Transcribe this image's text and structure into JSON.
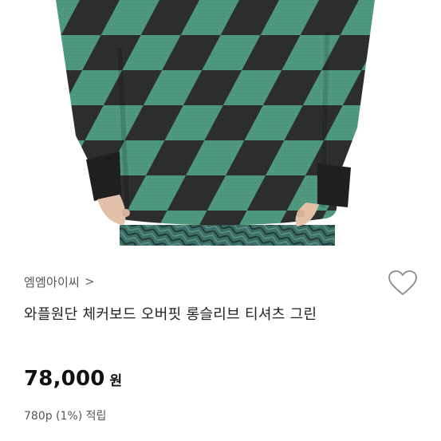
{
  "product": {
    "brand": "엠엠아이씨",
    "brand_chevron": ">",
    "title": "와플원단 체커보드 오버핏 롱슬리브 티셔츠 그린",
    "price": "78,000",
    "currency": "원",
    "points": "780p (1%) 적립"
  },
  "icons": {
    "brand_link": "chevron-right-icon",
    "wishlist": "heart-outline-icon"
  },
  "colors": {
    "shirt_green": "#4f9a7e",
    "shirt_dark": "#2b2b2b",
    "text_primary": "#222222",
    "text_secondary": "#555555"
  }
}
